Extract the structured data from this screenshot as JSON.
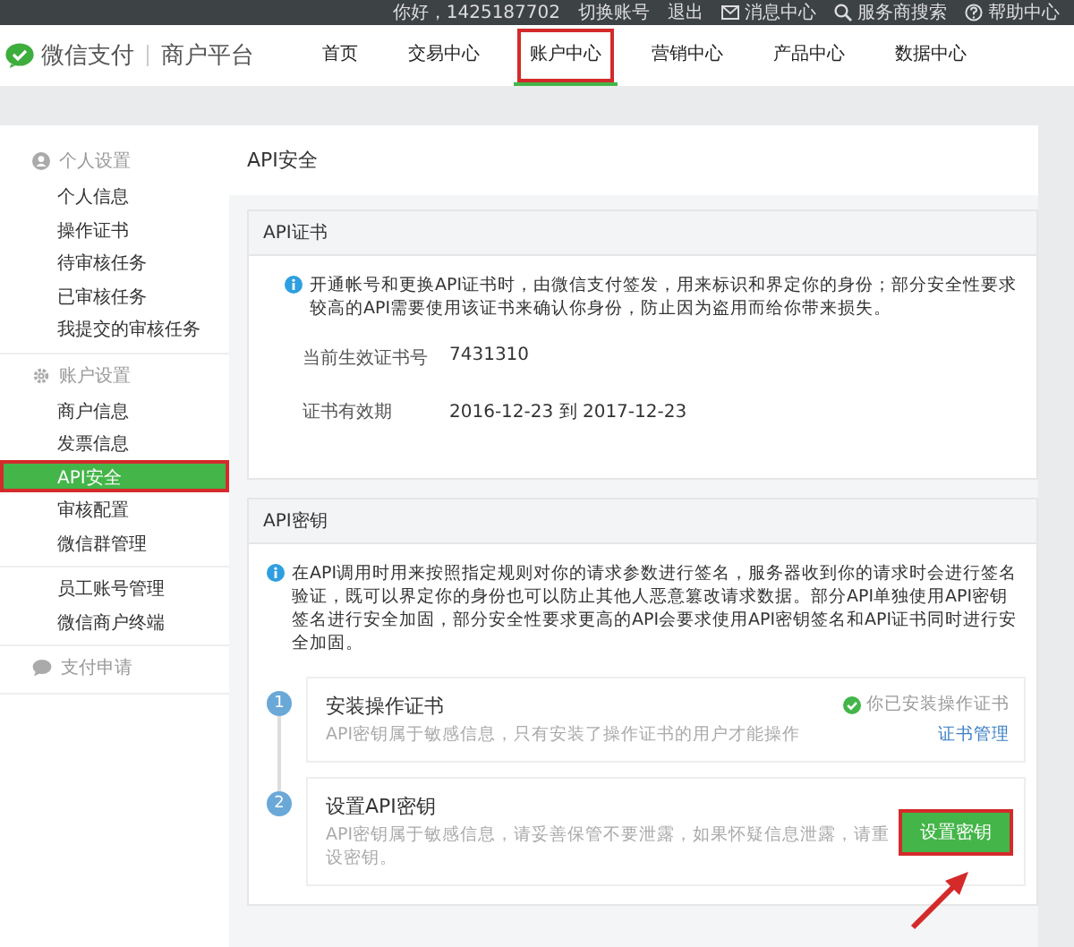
{
  "top_bar": {
    "greeting": "你好，1425187702",
    "links": [
      "切换账号",
      "退出"
    ],
    "items": [
      {
        "kind": "mail",
        "label": "消息中心"
      },
      {
        "kind": "search",
        "label": "服务商搜索"
      },
      {
        "kind": "help",
        "label": "帮助中心"
      }
    ]
  },
  "header": {
    "logo": "微信支付",
    "subtitle": "商户平台",
    "nav": [
      {
        "label": "首页",
        "selected": false,
        "annotated": false
      },
      {
        "label": "交易中心",
        "selected": false,
        "annotated": false
      },
      {
        "label": "账户中心",
        "selected": true,
        "annotated": true
      },
      {
        "label": "营销中心",
        "selected": false,
        "annotated": false
      },
      {
        "label": "产品中心",
        "selected": false,
        "annotated": false
      },
      {
        "label": "数据中心",
        "selected": false,
        "annotated": false
      }
    ]
  },
  "sidebar": {
    "groups": [
      {
        "title": "个人设置",
        "kind": "person",
        "items": [
          {
            "label": "个人信息",
            "selected": false,
            "annotated": false
          },
          {
            "label": "操作证书",
            "selected": false,
            "annotated": false
          },
          {
            "label": "待审核任务",
            "selected": false,
            "annotated": false
          },
          {
            "label": "已审核任务",
            "selected": false,
            "annotated": false
          },
          {
            "label": "我提交的审核任务",
            "selected": false,
            "annotated": false
          }
        ]
      },
      {
        "title": "账户设置",
        "kind": "gear",
        "items": [
          {
            "label": "商户信息",
            "selected": false,
            "annotated": false
          },
          {
            "label": "发票信息",
            "selected": false,
            "annotated": false
          },
          {
            "label": "API安全",
            "selected": true,
            "annotated": true
          },
          {
            "label": "审核配置",
            "selected": false,
            "annotated": false
          },
          {
            "label": "微信群管理",
            "selected": false,
            "annotated": false
          }
        ]
      },
      {
        "items": [
          {
            "label": "员工账号管理",
            "selected": false,
            "annotated": false
          },
          {
            "label": "微信商户终端",
            "selected": false,
            "annotated": false
          }
        ]
      },
      {
        "title": "支付申请",
        "kind": "chat"
      }
    ]
  },
  "page_title": "API安全",
  "cert_panel": {
    "title": "API证书",
    "notice": "开通帐号和更换API证书时，由微信支付签发，用来标识和界定你的身份；部分安全性要求较高的API需要使用该证书来确认你身份，防止因为盗用而给你带来损失。",
    "fields": [
      {
        "label": "当前生效证书号",
        "value": "7431310"
      },
      {
        "label": "证书有效期",
        "value": "2016-12-23  到  2017-12-23"
      }
    ]
  },
  "key_panel": {
    "title": "API密钥",
    "notice": "在API调用时用来按照指定规则对你的请求参数进行签名，服务器收到你的请求时会进行签名验证，既可以界定你的身份也可以防止其他人恶意篡改请求数据。部分API单独使用API密钥签名进行安全加固，部分安全性要求更高的API会要求使用API密钥签名和API证书同时进行安全加固。",
    "steps": [
      {
        "kind": "status",
        "number": "1",
        "title": "安装操作证书",
        "description": "API密钥属于敏感信息，只有安装了操作证书的用户才能操作",
        "status": "你已安装操作证书",
        "link": "证书管理"
      },
      {
        "kind": "button",
        "number": "2",
        "title": "设置API密钥",
        "description": "API密钥属于敏感信息，请妥善保管不要泄露，如果怀疑信息泄露，请重设密钥。",
        "button": "设置密钥",
        "annotated": true
      }
    ]
  }
}
